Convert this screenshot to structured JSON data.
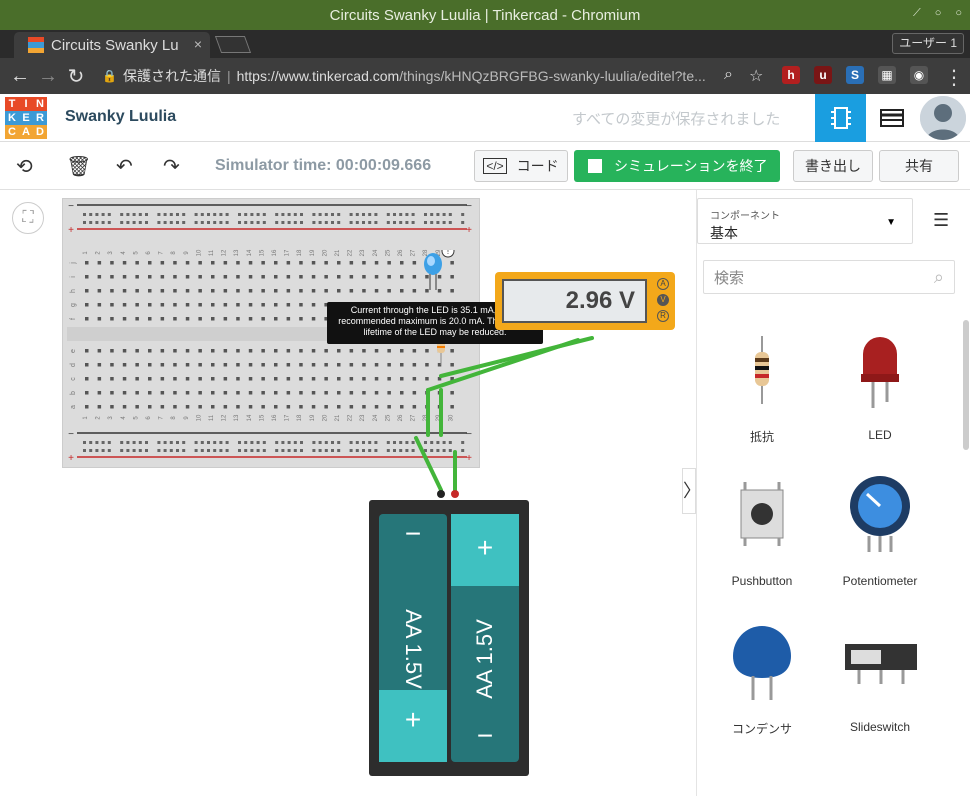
{
  "window": {
    "title": "Circuits Swanky Luulia | Tinkercad - Chromium"
  },
  "tab": {
    "label": "Circuits Swanky Lu",
    "close": "×"
  },
  "profile_button": "ユーザー 1",
  "address": {
    "secure_label": "保護された通信",
    "url_host": "https://www.tinkercad.com",
    "url_path": "/things/kHNQzBRGFBG-swanky-luulia/editel?te..."
  },
  "extensions": [
    {
      "name": "h-extension-icon",
      "glyph": "h",
      "color": "#b21f1f"
    },
    {
      "name": "ublock-icon",
      "glyph": "u",
      "color": "#7a1515",
      "badge": "2"
    },
    {
      "name": "s-extension-icon",
      "glyph": "S",
      "color": "#2a6fb6"
    },
    {
      "name": "qr-extension-icon",
      "glyph": "▦",
      "color": "#555"
    },
    {
      "name": "chat-extension-icon",
      "glyph": "◉",
      "color": "#555"
    }
  ],
  "header": {
    "logo_letters": [
      "T",
      "I",
      "N",
      "K",
      "E",
      "R",
      "C",
      "A",
      "D"
    ],
    "logo_colors": [
      "#e84a27",
      "#e84a27",
      "#e84a27",
      "#3c9ad6",
      "#3c9ad6",
      "#3c9ad6",
      "#f2a533",
      "#f2a533",
      "#f2a533"
    ],
    "project_name": "Swanky Luulia",
    "save_status": "すべての変更が保存されました"
  },
  "toolbar": {
    "sim_time": "Simulator time: 00:00:09.666",
    "code_label": "コード",
    "stop_label": "シミュレーションを終了",
    "export_label": "書き出し",
    "share_label": "共有"
  },
  "circuit": {
    "tooltip": "Current through the LED is 35.1 mA, while recommended maximum is 20.0 mA. The usable lifetime of the LED may be reduced.",
    "meter_reading": "2.96 V",
    "meter_modes": [
      "A",
      "V",
      "R"
    ],
    "row_labels_top": [
      "j",
      "i",
      "h",
      "g",
      "f"
    ],
    "row_labels_bottom": [
      "e",
      "d",
      "c",
      "b",
      "a"
    ],
    "battery_cells": [
      "AA 1.5V",
      "AA 1.5V"
    ],
    "rail_minus": "−",
    "rail_plus": "+"
  },
  "panel": {
    "components_caption": "コンポーネント",
    "components_value": "基本",
    "search_placeholder": "検索",
    "components": [
      {
        "name": "抵抗",
        "id": "resistor"
      },
      {
        "name": "LED",
        "id": "led"
      },
      {
        "name": "Pushbutton",
        "id": "pushbutton"
      },
      {
        "name": "Potentiometer",
        "id": "potentiometer"
      },
      {
        "name": "コンデンサ",
        "id": "capacitor"
      },
      {
        "name": "Slideswitch",
        "id": "slideswitch"
      }
    ]
  }
}
